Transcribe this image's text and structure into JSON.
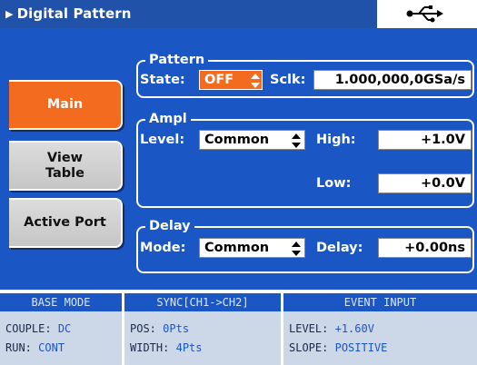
{
  "title": "Digital Pattern",
  "usb_icon": "usb-icon",
  "softkeys": {
    "main": "Main",
    "view_table_line1": "View",
    "view_table_line2": "Table",
    "active_port": "Active Port"
  },
  "pattern": {
    "title": "Pattern",
    "state_label": "State:",
    "state_value": "OFF",
    "sclk_label": "Sclk:",
    "sclk_value": "1.000,000,0GSa/s"
  },
  "ampl": {
    "title": "Ampl",
    "level_label": "Level:",
    "level_value": "Common",
    "high_label": "High:",
    "high_value": "+1.0V",
    "low_label": "Low:",
    "low_value": "+0.0V"
  },
  "delay": {
    "title": "Delay",
    "mode_label": "Mode:",
    "mode_value": "Common",
    "delay_label": "Delay:",
    "delay_value": "+0.00ns"
  },
  "status": {
    "base_mode": {
      "header": "BASE MODE",
      "couple_label": "COUPLE:",
      "couple_value": "DC",
      "run_label": "RUN:",
      "run_value": "CONT"
    },
    "sync": {
      "header": "SYNC[CH1->CH2]",
      "pos_label": "POS:",
      "pos_value": "0Pts",
      "width_label": "WIDTH:",
      "width_value": "4Pts"
    },
    "event": {
      "header": "EVENT INPUT",
      "level_label": "LEVEL:",
      "level_value": "+1.60V",
      "slope_label": "SLOPE:",
      "slope_value": "POSITIVE"
    }
  },
  "colors": {
    "title_bar": "#1f52a8",
    "panel": "#1a56c4",
    "accent": "#f26b1f",
    "status_bg": "#ccd7e8"
  }
}
